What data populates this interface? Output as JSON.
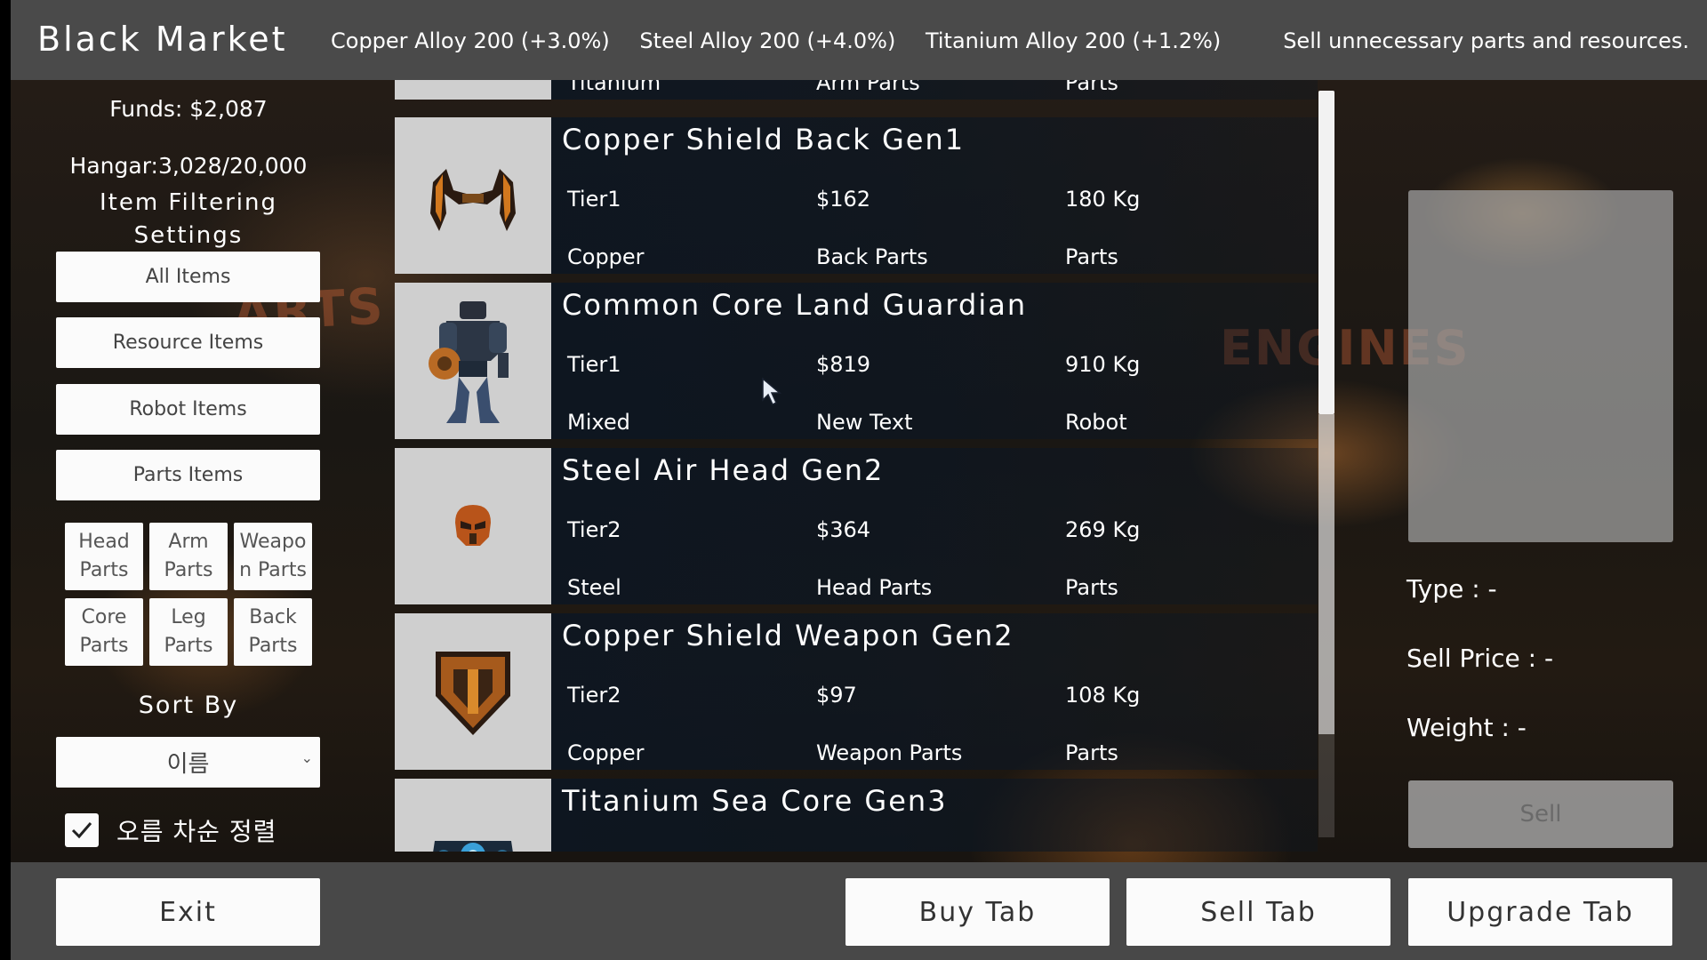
{
  "header": {
    "title": "Black Market",
    "prices": [
      "Copper Alloy 200 (+3.0%)",
      "Steel Alloy 200 (+4.0%)",
      "Titanium Alloy 200 (+1.2%)"
    ],
    "hint": "Sell unnecessary parts and resources."
  },
  "sidebar": {
    "funds": "Funds: $2,087",
    "hangar": "Hangar:3,028/20,000",
    "filter_title_line1": "Item Filtering",
    "filter_title_line2": "Settings",
    "filters": [
      "All Items",
      "Resource Items",
      "Robot Items",
      "Parts Items"
    ],
    "parts": [
      {
        "line1": "Head",
        "line2": "Parts"
      },
      {
        "line1": "Arm",
        "line2": "Parts"
      },
      {
        "line1": "Weapo",
        "line2": "n Parts"
      },
      {
        "line1": "Core",
        "line2": "Parts"
      },
      {
        "line1": "Leg",
        "line2": "Parts"
      },
      {
        "line1": "Back",
        "line2": "Parts"
      }
    ],
    "sort_label": "Sort By",
    "sort_value": "이름",
    "ascending_label": "오름 차순 정렬",
    "ascending_checked": true
  },
  "items": [
    {
      "name": "",
      "tier": "Titanium",
      "price": "Arm Parts",
      "weight": "Parts",
      "material": "",
      "type": "",
      "category": "",
      "icon": "partial-row"
    },
    {
      "name": "Copper Shield Back Gen1",
      "tier": "Tier1",
      "price": "$162",
      "weight": "180 Kg",
      "material": "Copper",
      "type": "Back Parts",
      "category": "Parts",
      "icon": "back-wings-icon"
    },
    {
      "name": "Common Core Land Guardian",
      "tier": "Tier1",
      "price": "$819",
      "weight": "910 Kg",
      "material": "Mixed",
      "type": "New Text",
      "category": "Robot",
      "icon": "robot-icon"
    },
    {
      "name": "Steel Air Head Gen2",
      "tier": "Tier2",
      "price": "$364",
      "weight": "269 Kg",
      "material": "Steel",
      "type": "Head Parts",
      "category": "Parts",
      "icon": "helmet-icon"
    },
    {
      "name": "Copper Shield Weapon Gen2",
      "tier": "Tier2",
      "price": "$97",
      "weight": "108 Kg",
      "material": "Copper",
      "type": "Weapon Parts",
      "category": "Parts",
      "icon": "shield-icon"
    },
    {
      "name": "Titanium Sea Core Gen3",
      "tier": "",
      "price": "",
      "weight": "",
      "material": "",
      "type": "",
      "category": "",
      "icon": "core-icon"
    }
  ],
  "detail": {
    "type": "Type : -",
    "sell_price": "Sell Price : -",
    "weight": "Weight : -",
    "sell_button": "Sell"
  },
  "footer": {
    "exit": "Exit",
    "buy_tab": "Buy Tab",
    "sell_tab": "Sell Tab",
    "upgrade_tab": "Upgrade Tab"
  },
  "background_signs": [
    "ARTS &",
    "ENGINES"
  ],
  "colors": {
    "topbar": "#4a4a4a",
    "bottombar": "#484848",
    "button_bg": "#fbfbfb",
    "row_bg": "#0c1622"
  }
}
